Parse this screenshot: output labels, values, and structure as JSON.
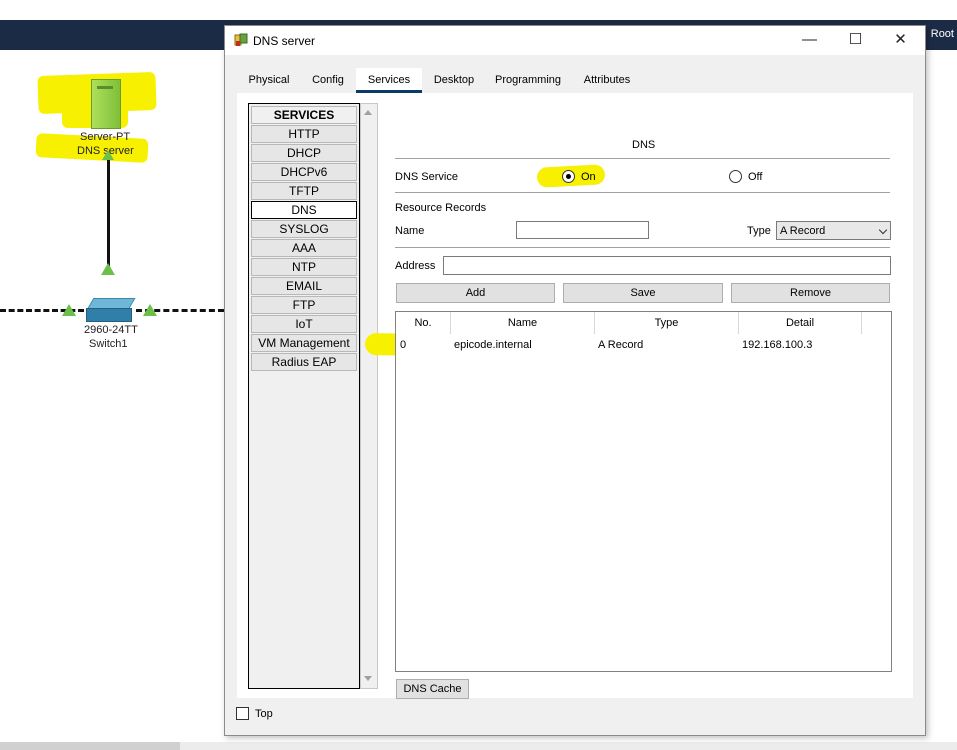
{
  "topbar": {
    "label": "Root"
  },
  "workspace": {
    "server": {
      "type_label": "Server-PT",
      "name_label": "DNS server"
    },
    "switch": {
      "type_label": "2960-24TT",
      "name_label": "Switch1"
    }
  },
  "window": {
    "title": "DNS server",
    "controls": {
      "minimize": "—",
      "maximize": "☐",
      "close": "✕"
    },
    "tabs": [
      {
        "label": "Physical"
      },
      {
        "label": "Config"
      },
      {
        "label": "Services"
      },
      {
        "label": "Desktop"
      },
      {
        "label": "Programming"
      },
      {
        "label": "Attributes"
      }
    ],
    "active_tab": "Services",
    "services": [
      "SERVICES",
      "HTTP",
      "DHCP",
      "DHCPv6",
      "TFTP",
      "DNS",
      "SYSLOG",
      "AAA",
      "NTP",
      "EMAIL",
      "FTP",
      "IoT",
      "VM Management",
      "Radius EAP"
    ],
    "selected_service": "DNS",
    "dns": {
      "title": "DNS",
      "service_label": "DNS Service",
      "on_label": "On",
      "off_label": "Off",
      "service_state": "On",
      "resource_records_label": "Resource Records",
      "name_label": "Name",
      "name_value": "",
      "type_label": "Type",
      "type_value": "A Record",
      "address_label": "Address",
      "address_value": "",
      "buttons": {
        "add": "Add",
        "save": "Save",
        "remove": "Remove"
      },
      "table": {
        "columns": [
          "No.",
          "Name",
          "Type",
          "Detail"
        ],
        "rows": [
          {
            "no": "0",
            "name": "epicode.internal",
            "type": "A Record",
            "detail": "192.168.100.3"
          }
        ]
      },
      "cache_button": "DNS Cache"
    },
    "top_checkbox_label": "Top"
  },
  "colors": {
    "highlight": "#f7f000",
    "topbar": "#1c2b45",
    "tab_underline": "#0b3a6b",
    "link_indicator": "#6cc04a"
  }
}
